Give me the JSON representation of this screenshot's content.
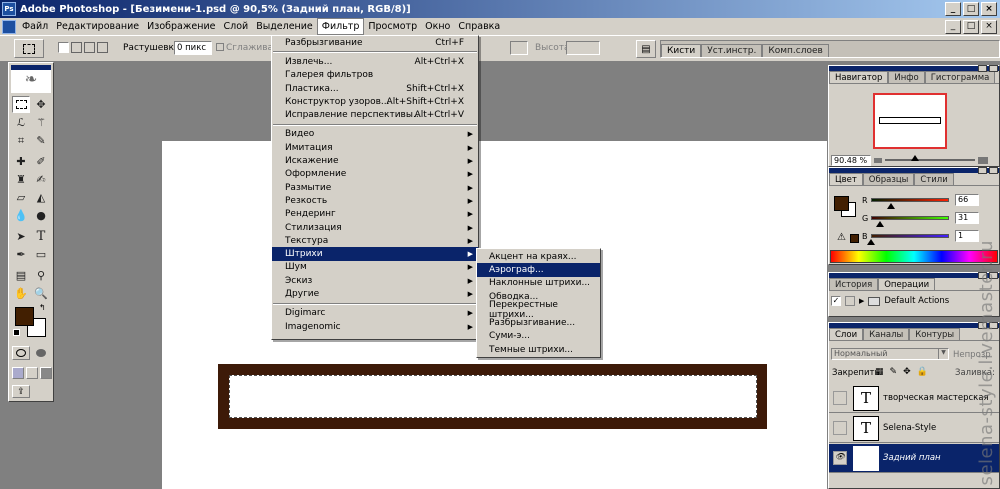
{
  "window": {
    "title": "Adobe Photoshop - [Безимени-1.psd @ 90,5% (Задний план, RGB/8)]",
    "app_icon": "Ps",
    "controls": [
      "_",
      "□",
      "×"
    ],
    "doc_controls": [
      "_",
      "□",
      "×"
    ]
  },
  "menubar": {
    "items": [
      "Файл",
      "Редактирование",
      "Изображение",
      "Слой",
      "Выделение",
      "Фильтр",
      "Просмотр",
      "Окно",
      "Справка"
    ],
    "active": "Фильтр"
  },
  "options": {
    "feather_label": "Растушевка:",
    "feather_value": "0 пикс",
    "antialias_label": "Сглаживание",
    "height_label": "Высота:",
    "tabs": [
      "Кисти",
      "Уст.инстр.",
      "Комп.слоев"
    ]
  },
  "filter_menu": {
    "groups": [
      [
        {
          "label": "Разбрызгивание",
          "shortcut": "Ctrl+F"
        }
      ],
      [
        {
          "label": "Извлечь...",
          "shortcut": "Alt+Ctrl+X"
        },
        {
          "label": "Галерея фильтров",
          "shortcut": ""
        },
        {
          "label": "Пластика...",
          "shortcut": "Shift+Ctrl+X"
        },
        {
          "label": "Конструктор узоров...",
          "shortcut": "Alt+Shift+Ctrl+X"
        },
        {
          "label": "Исправление перспективы...",
          "shortcut": "Alt+Ctrl+V"
        }
      ],
      [
        {
          "label": "Видео",
          "sub": true
        },
        {
          "label": "Имитация",
          "sub": true
        },
        {
          "label": "Искажение",
          "sub": true
        },
        {
          "label": "Оформление",
          "sub": true
        },
        {
          "label": "Размытие",
          "sub": true
        },
        {
          "label": "Резкость",
          "sub": true
        },
        {
          "label": "Рендеринг",
          "sub": true
        },
        {
          "label": "Стилизация",
          "sub": true
        },
        {
          "label": "Текстура",
          "sub": true
        },
        {
          "label": "Штрихи",
          "sub": true,
          "highlighted": true
        },
        {
          "label": "Шум",
          "sub": true
        },
        {
          "label": "Эскиз",
          "sub": true
        },
        {
          "label": "Другие",
          "sub": true
        }
      ],
      [
        {
          "label": "Digimarc",
          "sub": true
        },
        {
          "label": "Imagenomic",
          "sub": true
        }
      ]
    ]
  },
  "strokes_submenu": {
    "items": [
      {
        "label": "Акцент на краях..."
      },
      {
        "label": "Аэрограф...",
        "highlighted": true
      },
      {
        "label": "Наклонные штрихи..."
      },
      {
        "label": "Обводка..."
      },
      {
        "label": "Перекрестные штрихи..."
      },
      {
        "label": "Разбрызгивание..."
      },
      {
        "label": "Суми-э..."
      },
      {
        "label": "Темные штрихи..."
      }
    ]
  },
  "navigator": {
    "tabs": [
      "Навигатор",
      "Инфо",
      "Гистограмма"
    ],
    "zoom": "90.48 %"
  },
  "color_panel": {
    "tabs": [
      "Цвет",
      "Образцы",
      "Стили"
    ],
    "channels": [
      {
        "label": "R",
        "value": "66",
        "fraction": 0.26
      },
      {
        "label": "G",
        "value": "31",
        "fraction": 0.12
      },
      {
        "label": "B",
        "value": "1",
        "fraction": 0.0
      }
    ],
    "foreground_color": "#421f01"
  },
  "actions_panel": {
    "tabs": [
      "История",
      "Операции"
    ],
    "item": "Default Actions"
  },
  "layers_panel": {
    "tabs": [
      "Слои",
      "Каналы",
      "Контуры"
    ],
    "blend_mode": "Нормальный",
    "opacity_label": "Непрозр",
    "lock_label": "Закрепить:",
    "fill_label": "Заливка:",
    "layers": [
      {
        "name": "творческая мастерская",
        "thumb": "T",
        "selected": false,
        "visible": false
      },
      {
        "name": "Selena-Style",
        "thumb": "T",
        "selected": false,
        "visible": false
      },
      {
        "name": "Задний план",
        "thumb": "",
        "selected": true,
        "visible": true
      }
    ]
  },
  "canvas": {
    "frame_color": "#3d1a08"
  },
  "watermark": "selena-style.livemaster.ru"
}
